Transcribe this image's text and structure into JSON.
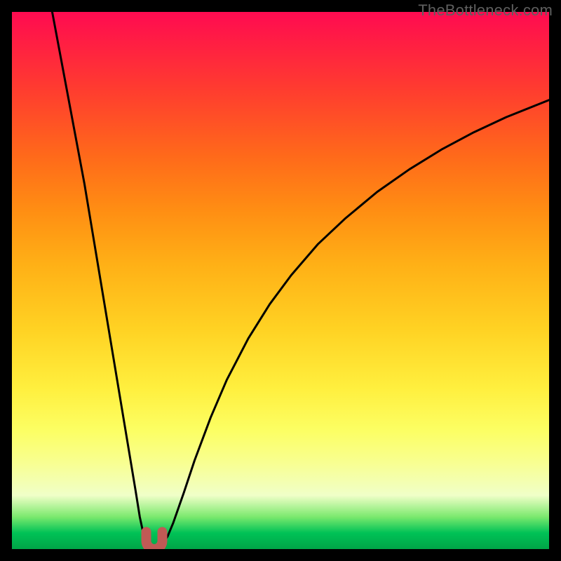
{
  "attribution": "TheBottleneck.com",
  "palette": {
    "frame": "#000000",
    "curve": "#000000",
    "marker": "#c05a55",
    "gradient_top": "#ff0b51",
    "gradient_bottom": "#00a547"
  },
  "chart_data": {
    "type": "line",
    "title": "",
    "xlabel": "",
    "ylabel": "",
    "xlim": [
      0,
      100
    ],
    "ylim": [
      0,
      100
    ],
    "grid": false,
    "annotations": [],
    "series": [
      {
        "name": "left-branch",
        "x": [
          7.5,
          9,
          10.5,
          12,
          13.5,
          15,
          16.5,
          18,
          19.5,
          21,
          22,
          23,
          23.8,
          24.4,
          24.8,
          25,
          25.2,
          25.5
        ],
        "y": [
          100,
          92,
          84,
          76,
          68,
          59,
          50,
          41,
          32,
          23,
          17,
          11,
          6,
          3.2,
          1.6,
          0.9,
          0.6,
          0.4
        ]
      },
      {
        "name": "right-branch",
        "x": [
          27.5,
          28,
          29,
          30,
          32,
          34,
          37,
          40,
          44,
          48,
          52,
          57,
          62,
          68,
          74,
          80,
          86,
          92,
          98,
          100
        ],
        "y": [
          0.4,
          0.9,
          2.4,
          4.8,
          10.5,
          16.5,
          24.5,
          31.5,
          39.2,
          45.6,
          51.0,
          56.8,
          61.5,
          66.5,
          70.7,
          74.4,
          77.6,
          80.4,
          82.8,
          83.6
        ]
      }
    ],
    "marker": {
      "name": "u-shaped-dip-marker",
      "x_range": [
        25,
        28
      ],
      "y_range": [
        0,
        3.2
      ],
      "color": "#c05a55"
    }
  }
}
